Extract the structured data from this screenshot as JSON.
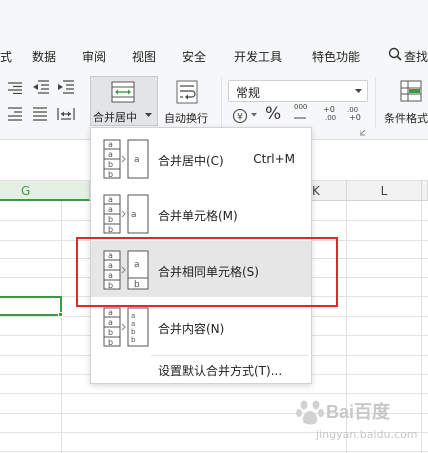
{
  "menu_tabs": [
    "式",
    "数据",
    "审阅",
    "视图",
    "安全",
    "开发工具",
    "特色功能",
    "查找"
  ],
  "ribbon": {
    "merge_label": "合并居中",
    "auto_wrap_label": "自动换行",
    "number_format": "常规",
    "cond_format_label": "条件格式",
    "percent_symbol": "%",
    "comma_symbol": "000"
  },
  "columns": [
    "G",
    "K",
    "L"
  ],
  "dropdown": {
    "items": [
      {
        "label": "合并居中(C)",
        "shortcut": "Ctrl+M"
      },
      {
        "label": "合并单元格(M)",
        "shortcut": ""
      },
      {
        "label": "合并相同单元格(S)",
        "shortcut": ""
      },
      {
        "label": "合并内容(N)",
        "shortcut": ""
      }
    ],
    "footer": "设置默认合并方式(T)..."
  },
  "watermark": {
    "text": "Bai百度",
    "sub": "jingyan.baidu.com"
  },
  "colors": {
    "highlight_border": "#e0292c",
    "selection": "#3e9a3f",
    "ribbon_bg": "#f6f7f8"
  }
}
